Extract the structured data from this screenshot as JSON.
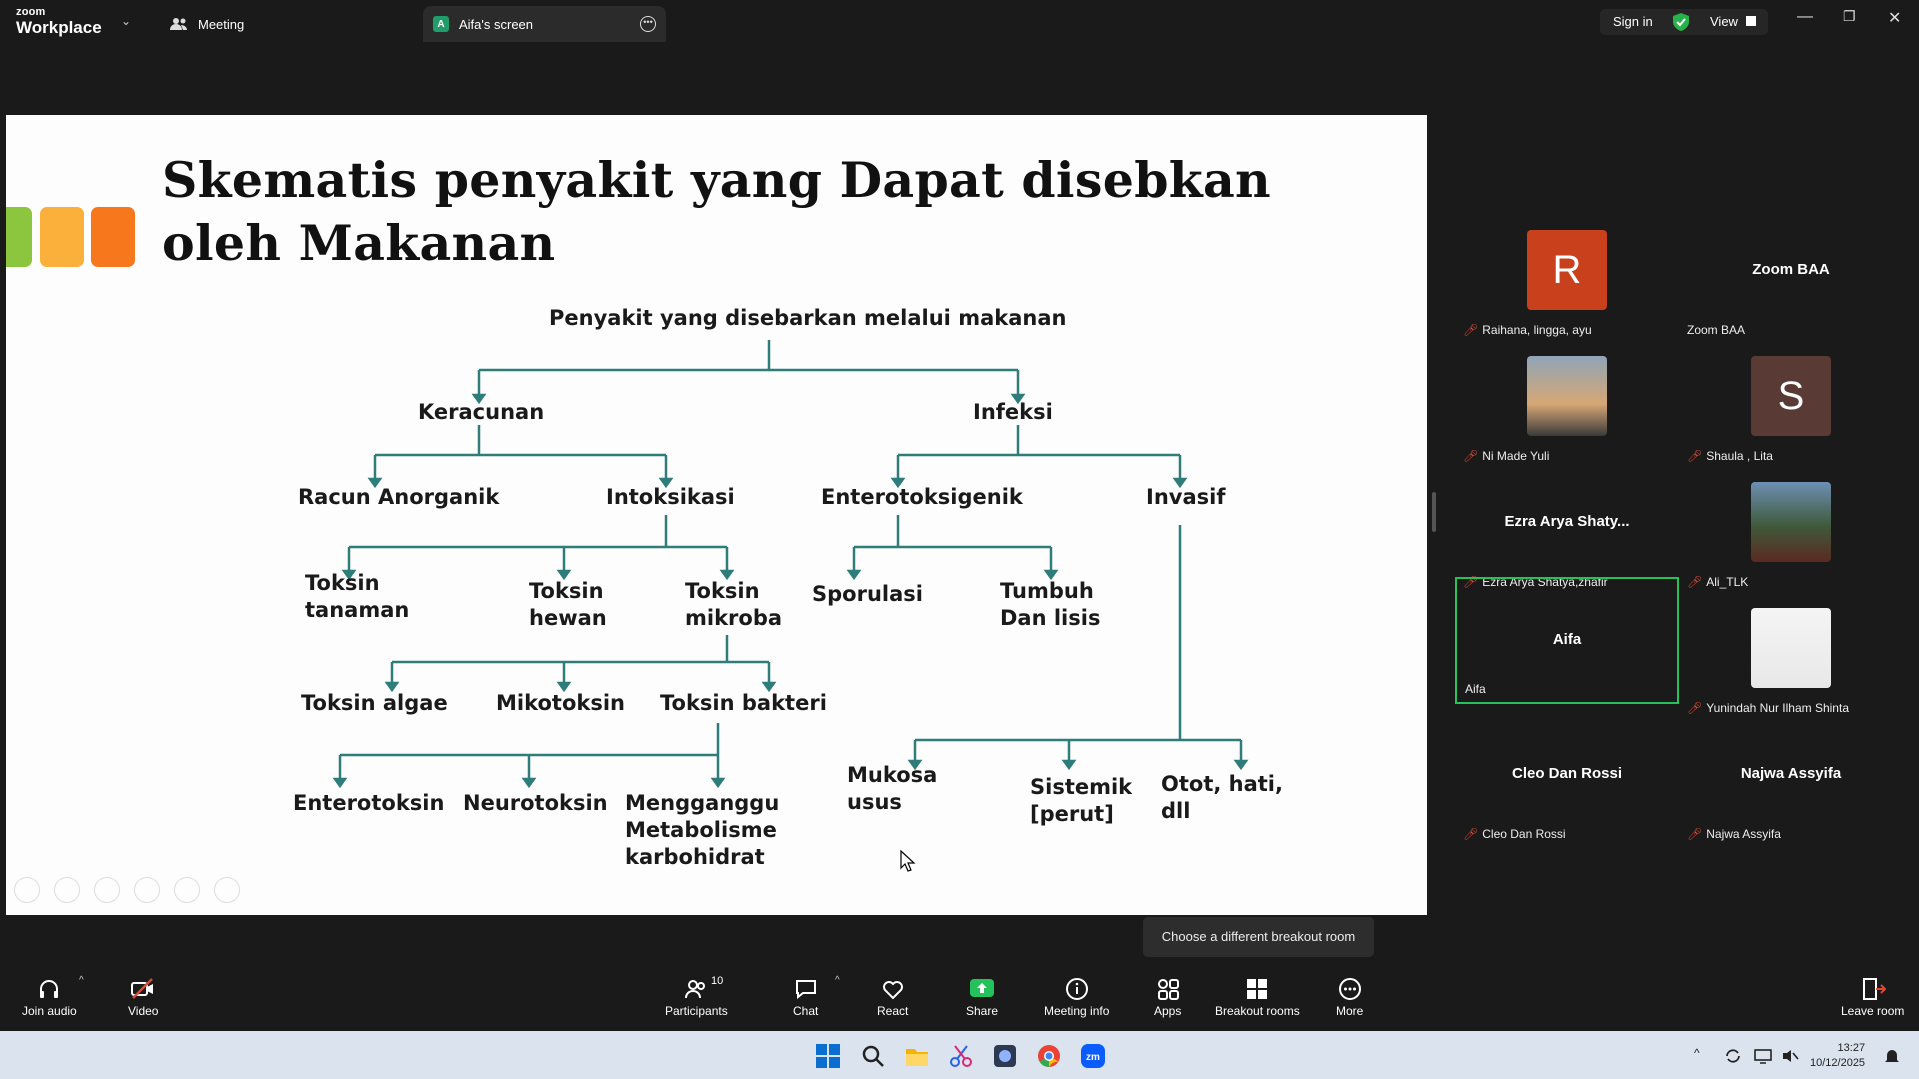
{
  "app": {
    "logo_line1": "zoom",
    "logo_line2": "Workplace"
  },
  "tabs": {
    "meeting": "Meeting",
    "screen": "Aifa's screen",
    "screen_avatar": "A"
  },
  "header": {
    "signin": "Sign in",
    "view": "View"
  },
  "slide": {
    "title_line1": "Skematis penyakit yang Dapat disebkan",
    "title_line2": "oleh Makanan",
    "nodes": {
      "root": "Penyakit yang disebarkan melalui makanan",
      "keracunan": "Keracunan",
      "infeksi": "Infeksi",
      "racun": "Racun Anorganik",
      "intoksikasi": "Intoksikasi",
      "entero_gen": "Enterotoksigenik",
      "invasif": "Invasif",
      "tanaman1": "Toksin",
      "tanaman2": "tanaman",
      "hewan1": "Toksin",
      "hewan2": "hewan",
      "mikroba1": "Toksin",
      "mikroba2": "mikroba",
      "sporulasi": "Sporulasi",
      "tumbuh1": "Tumbuh",
      "tumbuh2": "Dan lisis",
      "algae": "Toksin algae",
      "mikotoksin": "Mikotoksin",
      "bakteri": "Toksin bakteri",
      "enterotoksin": "Enterotoksin",
      "neurotoksin": "Neurotoksin",
      "meng1": "Mengganggu",
      "meng2": "Metabolisme",
      "meng3": "karbohidrat",
      "mukosa1": "Mukosa",
      "mukosa2": "usus",
      "sistemik1": "Sistemik",
      "sistemik2": "[perut]",
      "otot1": "Otot, hati,",
      "otot2": "dll"
    },
    "line_color": "#2e7d7a"
  },
  "participants": [
    {
      "name": "Raihana, lingga, ayu",
      "avatar_letter": "R",
      "avatar_color": "#c9401c",
      "muted": true
    },
    {
      "name": "Zoom BAA",
      "center": "Zoom BAA",
      "muted": false
    },
    {
      "name": "Ni Made Yuli",
      "photo": "sunset",
      "muted": true
    },
    {
      "name": "Shaula , Lita",
      "avatar_letter": "S",
      "avatar_color": "#5a3a34",
      "muted": true
    },
    {
      "name": "Ezra Arya Shatya,zhafir",
      "center": "Ezra Arya Shaty...",
      "muted": true
    },
    {
      "name": "Ali_TLK",
      "photo": "mountain",
      "muted": true
    },
    {
      "name": "Aifa",
      "center": "Aifa",
      "muted": false,
      "active": true
    },
    {
      "name": "Yunindah Nur Ilham Shinta",
      "photo": "portrait",
      "muted": true
    },
    {
      "name": "Cleo Dan Rossi",
      "center": "Cleo Dan Rossi",
      "muted": true
    },
    {
      "name": "Najwa Assyifa",
      "center": "Najwa Assyifa",
      "muted": true
    }
  ],
  "tooltip": "Choose a different breakout room",
  "toolbar": {
    "join_audio": "Join audio",
    "video": "Video",
    "participants": "Participants",
    "participants_count": "10",
    "chat": "Chat",
    "react": "React",
    "share": "Share",
    "meeting_info": "Meeting info",
    "apps": "Apps",
    "breakout": "Breakout rooms",
    "more": "More",
    "leave": "Leave room"
  },
  "taskbar": {
    "time": "13:27",
    "date": "10/12/2025"
  }
}
